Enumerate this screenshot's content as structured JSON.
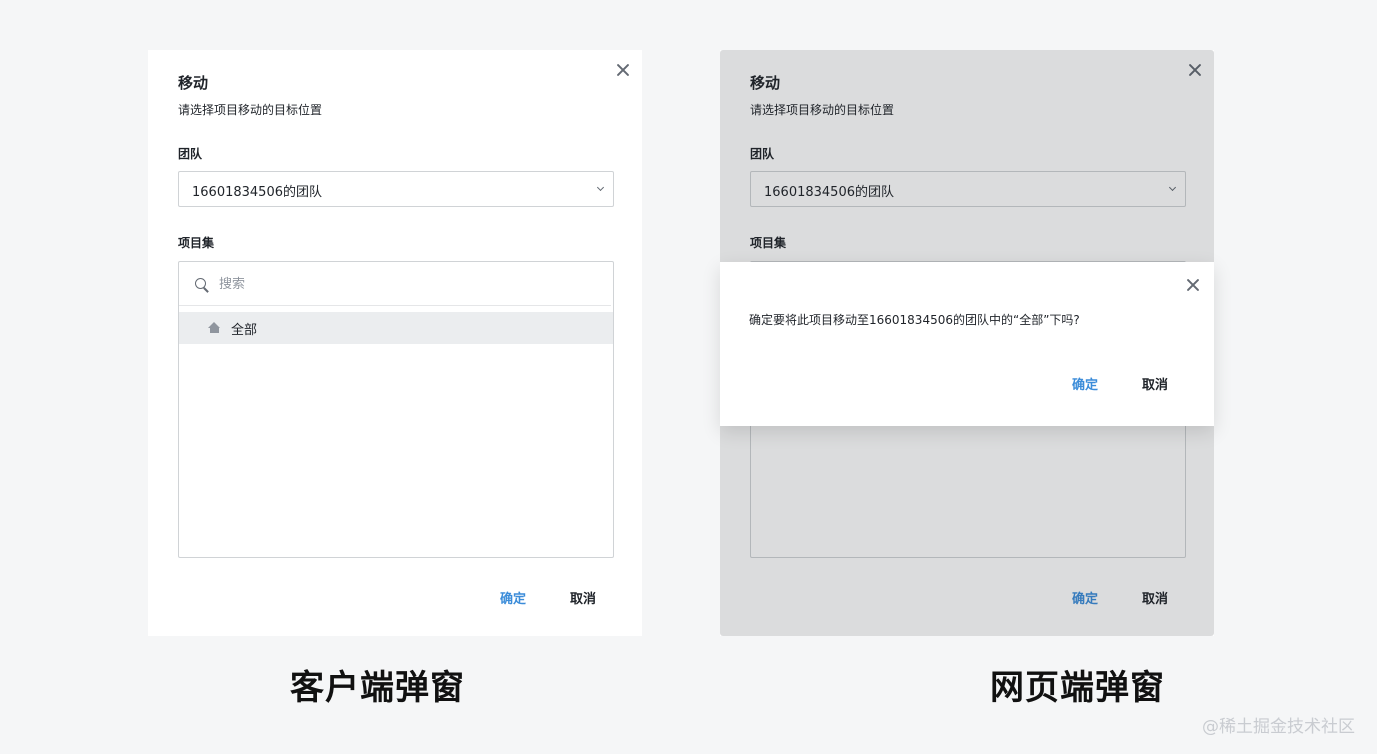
{
  "left_dialog": {
    "title": "移动",
    "subtitle": "请选择项目移动的目标位置",
    "team_label": "团队",
    "team_value": "16601834506的团队",
    "projset_label": "项目集",
    "search_placeholder": "搜索",
    "tree_items": [
      {
        "label": "全部",
        "icon": "home-icon"
      }
    ],
    "confirm_label": "确定",
    "cancel_label": "取消"
  },
  "right_dialog": {
    "title": "移动",
    "subtitle": "请选择项目移动的目标位置",
    "team_label": "团队",
    "team_value": "16601834506的团队",
    "projset_label": "项目集",
    "confirm_label": "确定",
    "cancel_label": "取消"
  },
  "confirm_dialog": {
    "message": "确定要将此项目移动至16601834506的团队中的“全部”下吗?",
    "confirm_label": "确定",
    "cancel_label": "取消"
  },
  "captions": {
    "left": "客户端弹窗",
    "right": "网页端弹窗"
  },
  "watermark": "@稀土掘金技术社区",
  "colors": {
    "accent": "#3b8cd9",
    "background": "#f5f6f7",
    "selected_row": "#ebedef"
  }
}
